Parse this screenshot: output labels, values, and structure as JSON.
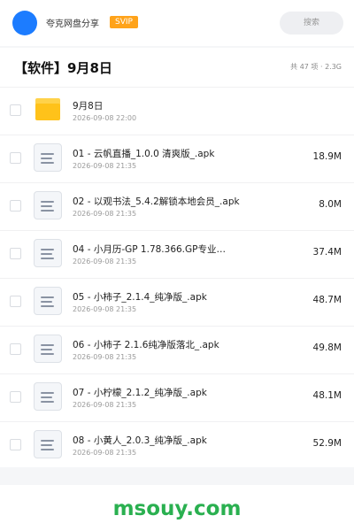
{
  "header": {
    "app_name": "夸克网盘分享",
    "badge": "SVIP",
    "search_placeholder": "搜索"
  },
  "title_bar": {
    "title": "【软件】9月8日",
    "item_count": "共 47 项",
    "separator": "·",
    "total_size": "2.3G"
  },
  "colors": {
    "avatar": "#1c7cff",
    "badge": "#ffa31a",
    "folder": "#ffc21a",
    "watermark": "#2ab050"
  },
  "items": [
    {
      "type": "folder",
      "icon": "folder-icon",
      "name": "9月8日",
      "date": "2026-09-08 22:00",
      "size": ""
    },
    {
      "type": "file",
      "icon": "file-icon",
      "name": "01 - 云帆直播_1.0.0 清爽版_.apk",
      "date": "2026-09-08 21:35",
      "size": "18.9M"
    },
    {
      "type": "file",
      "icon": "file-icon",
      "name": "02 - 以观书法_5.4.2解锁本地会员_.apk",
      "date": "2026-09-08 21:35",
      "size": "8.0M"
    },
    {
      "type": "file",
      "icon": "file-icon",
      "name": "04 - 小月历-GP 1.78.366.GP专业…",
      "date": "2026-09-08 21:35",
      "size": "37.4M"
    },
    {
      "type": "file",
      "icon": "file-icon",
      "name": "05 - 小柿子_2.1.4_纯净版_.apk",
      "date": "2026-09-08 21:35",
      "size": "48.7M"
    },
    {
      "type": "file",
      "icon": "file-icon",
      "name": "06 - 小柿子 2.1.6纯净版落北_.apk",
      "date": "2026-09-08 21:35",
      "size": "49.8M"
    },
    {
      "type": "file",
      "icon": "file-icon",
      "name": "07 - 小柠檬_2.1.2_纯净版_.apk",
      "date": "2026-09-08 21:35",
      "size": "48.1M"
    },
    {
      "type": "file",
      "icon": "file-icon",
      "name": "08 - 小黄人_2.0.3_纯净版_.apk",
      "date": "2026-09-08 21:35",
      "size": "52.9M"
    }
  ],
  "footer": {
    "watermark": "msouy.com"
  }
}
